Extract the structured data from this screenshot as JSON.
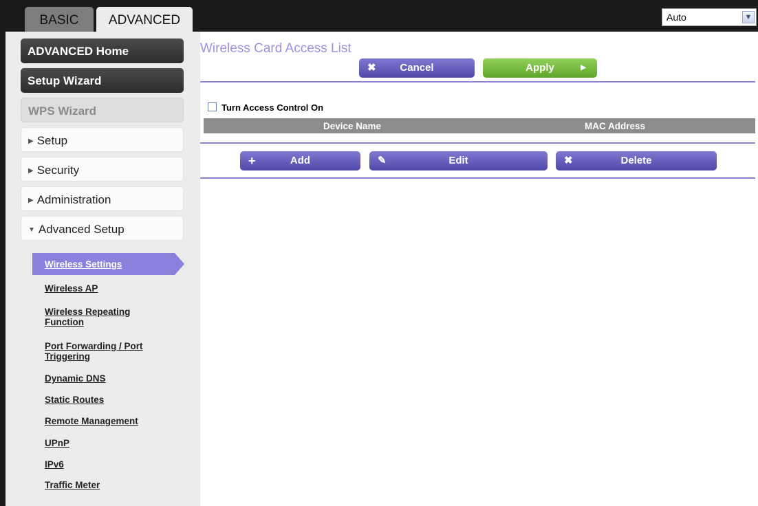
{
  "tabs": {
    "basic": "BASIC",
    "advanced": "ADVANCED"
  },
  "language_select": {
    "value": "Auto"
  },
  "sidebar": {
    "advanced_home": "ADVANCED Home",
    "setup_wizard": "Setup Wizard",
    "wps_wizard": "WPS Wizard",
    "setup": "Setup",
    "security": "Security",
    "administration": "Administration",
    "advanced_setup": "Advanced Setup",
    "links": [
      "Wireless Settings",
      "Wireless AP",
      "Wireless Repeating",
      "Function",
      "Port Forwarding / Port",
      "Triggering",
      "Dynamic DNS",
      "Static Routes",
      "Remote Management",
      "UPnP",
      "IPv6",
      "Traffic Meter"
    ]
  },
  "main": {
    "title": "Wireless Card Access List",
    "cancel": "Cancel",
    "apply": "Apply",
    "access_control_label": "Turn Access Control On",
    "access_control_checked": false,
    "columns": [
      "Device Name",
      "MAC Address"
    ],
    "add": "Add",
    "edit": "Edit",
    "delete": "Delete"
  },
  "colors": {
    "accent": "#8b80dc",
    "button_purple": "#5a52b0",
    "button_green": "#6cb336"
  }
}
